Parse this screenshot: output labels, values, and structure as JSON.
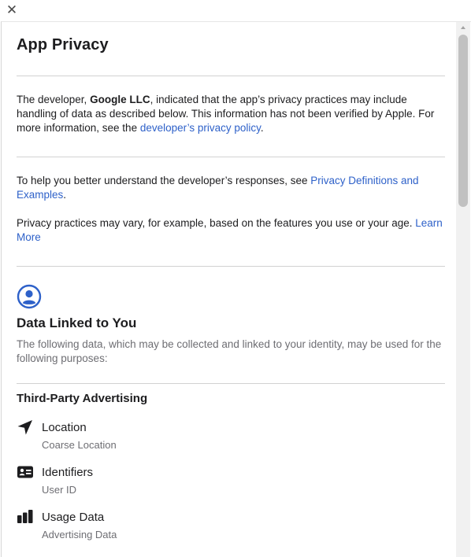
{
  "close_label": "✕",
  "title": "App Privacy",
  "intro": {
    "prefix": "The developer, ",
    "developer": "Google LLC",
    "middle": ", indicated that the app’s privacy practices may include handling of data as described below. This information has not been verified by Apple. For more information, see the ",
    "policy_link": "developer’s privacy policy",
    "suffix": "."
  },
  "help": {
    "prefix": "To help you better understand the developer’s responses, see ",
    "definitions_link": "Privacy Definitions and Examples",
    "suffix": "."
  },
  "vary": {
    "text": "Privacy practices may vary, for example, based on the features you use or your age. ",
    "learn_more": "Learn More"
  },
  "section": {
    "icon": "person-circle-icon",
    "title": "Data Linked to You",
    "description": "The following data, which may be collected and linked to your identity, may be used for the following purposes:",
    "purpose": "Third-Party Advertising",
    "categories": [
      {
        "icon": "location-arrow-icon",
        "name": "Location",
        "detail": "Coarse Location"
      },
      {
        "icon": "id-card-icon",
        "name": "Identifiers",
        "detail": "User ID"
      },
      {
        "icon": "bar-chart-icon",
        "name": "Usage Data",
        "detail": "Advertising Data"
      }
    ]
  },
  "colors": {
    "link": "#2e61c9",
    "text": "#1d1d1f",
    "secondary": "#6e6e73",
    "divider": "#d2d2d2"
  }
}
